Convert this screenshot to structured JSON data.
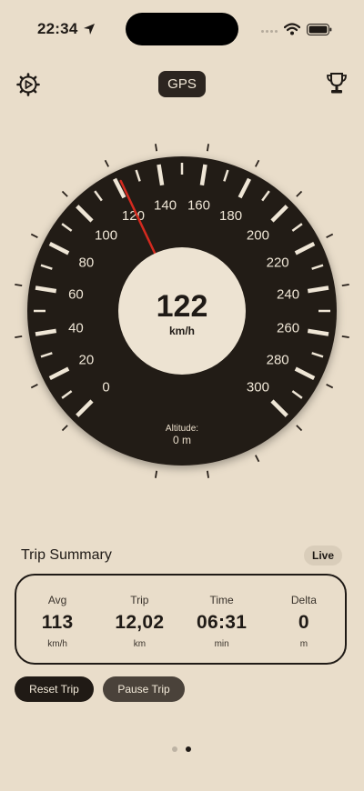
{
  "status_bar": {
    "time": "22:34"
  },
  "header": {
    "mode_chip": "GPS",
    "icons": [
      "gear-icon",
      "trophy-icon"
    ]
  },
  "speedometer": {
    "speed": "122",
    "unit": "km/h",
    "needle_value": 122,
    "scale_min": 0,
    "scale_max": 300,
    "scale_labels": [
      "0",
      "20",
      "40",
      "60",
      "80",
      "100",
      "120",
      "140",
      "160",
      "180",
      "200",
      "220",
      "240",
      "260",
      "280",
      "300"
    ],
    "altitude_label": "Altitude:",
    "altitude_value": "0 m",
    "colors": {
      "dial": "#231b15",
      "needle": "#d42a1f",
      "hub": "#ede3d2"
    }
  },
  "trip_summary": {
    "title": "Trip Summary",
    "badge": "Live",
    "stats": [
      {
        "label": "Avg",
        "value": "113",
        "unit": "km/h"
      },
      {
        "label": "Trip",
        "value": "12,02",
        "unit": "km"
      },
      {
        "label": "Time",
        "value": "06:31",
        "unit": "min"
      },
      {
        "label": "Delta",
        "value": "0",
        "unit": "m"
      }
    ]
  },
  "actions": {
    "reset": "Reset Trip",
    "pause": "Pause Trip"
  },
  "pager": {
    "count": 2,
    "active": 2
  }
}
